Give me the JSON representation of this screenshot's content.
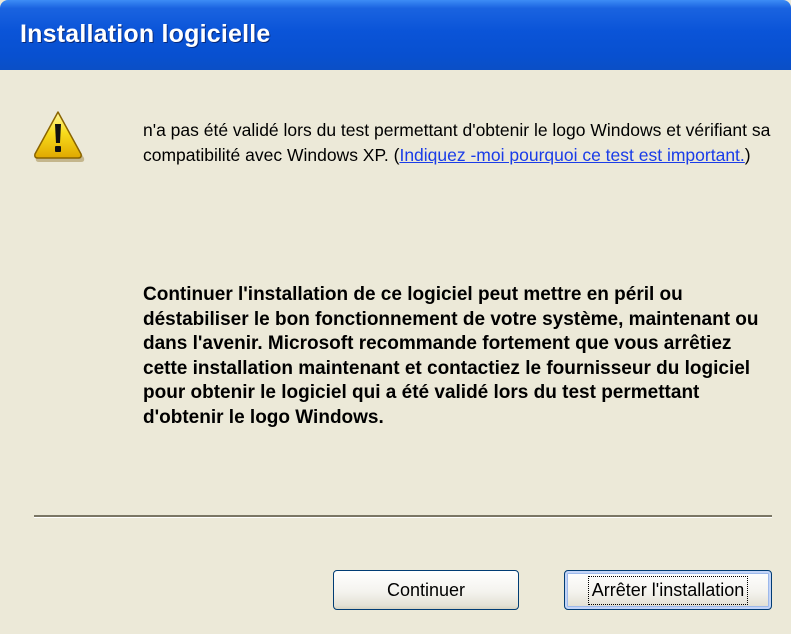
{
  "window": {
    "title": "Installation logicielle"
  },
  "message": {
    "text": "n'a pas été validé lors du test permettant d'obtenir le logo Windows et vérifiant sa compatibilité avec Windows XP. (",
    "link": "Indiquez -moi pourquoi ce test est important.",
    "link_close": ")",
    "warning": "Continuer l'installation de ce logiciel peut mettre en péril ou déstabiliser le bon fonctionnement de votre système, maintenant ou dans l'avenir. Microsoft recommande fortement que vous arrêtiez cette installation maintenant et contactiez le fournisseur du logiciel pour obtenir le logiciel qui a été validé lors du test permettant d'obtenir le logo Windows."
  },
  "buttons": {
    "continue_label": "Continuer",
    "stop_label": "Arrêter l'installation"
  },
  "icons": {
    "warning": "warning-icon"
  },
  "colors": {
    "titlebar": "#0a54d8",
    "background": "#ece9d8",
    "link": "#1a3ce8",
    "warning_icon": "#f5d21a"
  }
}
